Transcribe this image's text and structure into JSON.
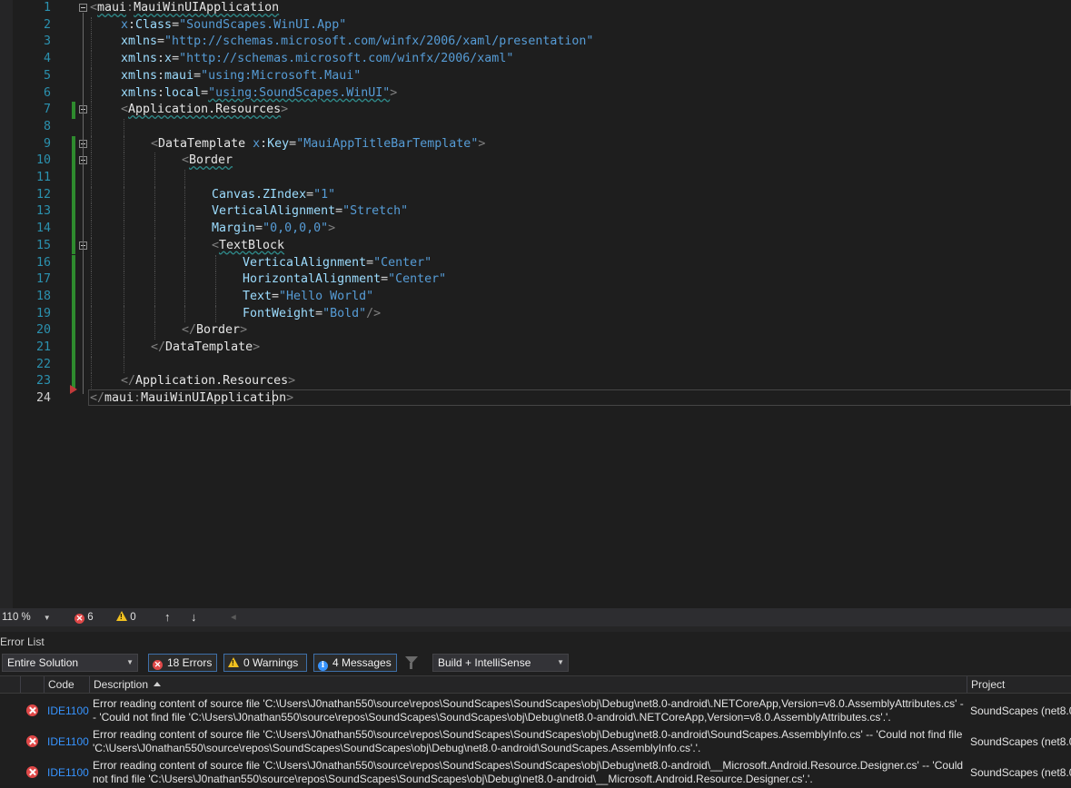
{
  "editor": {
    "lines": [
      {
        "n": "1"
      },
      {
        "n": "2"
      },
      {
        "n": "3"
      },
      {
        "n": "4"
      },
      {
        "n": "5"
      },
      {
        "n": "6"
      },
      {
        "n": "7"
      },
      {
        "n": "8"
      },
      {
        "n": "9"
      },
      {
        "n": "10"
      },
      {
        "n": "11"
      },
      {
        "n": "12"
      },
      {
        "n": "13"
      },
      {
        "n": "14"
      },
      {
        "n": "15"
      },
      {
        "n": "16"
      },
      {
        "n": "17"
      },
      {
        "n": "18"
      },
      {
        "n": "19"
      },
      {
        "n": "20"
      },
      {
        "n": "21"
      },
      {
        "n": "22"
      },
      {
        "n": "23"
      },
      {
        "n": "24"
      }
    ],
    "code": {
      "l1": {
        "lt": "<",
        "prefix": "maui",
        "colon": ":",
        "name": "MauiWinUIApplication"
      },
      "l2": {
        "attr_prefix": "x",
        "colon": ":",
        "attr": "Class",
        "eq": "=",
        "value": "\"SoundScapes.WinUI.App\""
      },
      "l3": {
        "attr": "xmlns",
        "eq": "=",
        "value": "\"http://schemas.microsoft.com/winfx/2006/xaml/presentation\""
      },
      "l4": {
        "attr": "xmlns",
        "colon": ":",
        "attr2": "x",
        "eq": "=",
        "value": "\"http://schemas.microsoft.com/winfx/2006/xaml\""
      },
      "l5": {
        "attr": "xmlns",
        "colon": ":",
        "attr2": "maui",
        "eq": "=",
        "value": "\"using:Microsoft.Maui\""
      },
      "l6": {
        "attr": "xmlns",
        "colon": ":",
        "attr2": "local",
        "eq": "=",
        "value": "\"using:SoundScapes.WinUI\"",
        "gt": ">"
      },
      "l7": {
        "lt": "<",
        "name": "Application.Resources",
        "gt": ">"
      },
      "l9": {
        "lt": "<",
        "name": "DataTemplate",
        "attr_prefix": "x",
        "colon": ":",
        "attr": "Key",
        "eq": "=",
        "value": "\"MauiAppTitleBarTemplate\"",
        "gt": ">"
      },
      "l10": {
        "lt": "<",
        "name": "Border"
      },
      "l12": {
        "attr": "Canvas.ZIndex",
        "eq": "=",
        "value": "\"1\""
      },
      "l13": {
        "attr": "VerticalAlignment",
        "eq": "=",
        "value": "\"Stretch\""
      },
      "l14": {
        "attr": "Margin",
        "eq": "=",
        "value": "\"0,0,0,0\"",
        "gt": ">"
      },
      "l15": {
        "lt": "<",
        "name": "TextBlock"
      },
      "l16": {
        "attr": "VerticalAlignment",
        "eq": "=",
        "value": "\"Center\""
      },
      "l17": {
        "attr": "HorizontalAlignment",
        "eq": "=",
        "value": "\"Center\""
      },
      "l18": {
        "attr": "Text",
        "eq": "=",
        "value": "\"Hello World\""
      },
      "l19": {
        "attr": "FontWeight",
        "eq": "=",
        "value": "\"Bold\"",
        "close": "/>"
      },
      "l20": {
        "lt": "</",
        "name": "Border",
        "gt": ">"
      },
      "l21": {
        "lt": "</",
        "name": "DataTemplate",
        "gt": ">"
      },
      "l23": {
        "lt": "</",
        "name": "Application.Resources",
        "gt": ">"
      },
      "l24": {
        "lt": "</",
        "prefix": "maui",
        "colon": ":",
        "name": "MauiWinUIApplication",
        "gt": ">"
      }
    }
  },
  "statusbar": {
    "zoom": "110 %",
    "errors": "6",
    "warnings": "0",
    "up_arrow": "↑",
    "down_arrow": "↓",
    "left_arrow": "◂"
  },
  "error_list": {
    "title": "Error List",
    "scope_select": "Entire Solution",
    "errors_button": "18 Errors",
    "warnings_button": "0 Warnings",
    "messages_button": "4 Messages",
    "build_select": "Build + IntelliSense",
    "columns": {
      "code": "Code",
      "description": "Description",
      "project": "Project"
    },
    "rows": [
      {
        "code": "IDE1100",
        "description": "Error reading content of source file 'C:\\Users\\J0nathan550\\source\\repos\\SoundScapes\\SoundScapes\\obj\\Debug\\net8.0-android\\.NETCoreApp,Version=v8.0.AssemblyAttributes.cs' -- 'Could not find file 'C:\\Users\\J0nathan550\\source\\repos\\SoundScapes\\SoundScapes\\obj\\Debug\\net8.0-android\\.NETCoreApp,Version=v8.0.AssemblyAttributes.cs'.'.",
        "project": "SoundScapes (net8.0-"
      },
      {
        "code": "IDE1100",
        "description": "Error reading content of source file 'C:\\Users\\J0nathan550\\source\\repos\\SoundScapes\\SoundScapes\\obj\\Debug\\net8.0-android\\SoundScapes.AssemblyInfo.cs' -- 'Could not find file 'C:\\Users\\J0nathan550\\source\\repos\\SoundScapes\\SoundScapes\\obj\\Debug\\net8.0-android\\SoundScapes.AssemblyInfo.cs'.'.",
        "project": "SoundScapes (net8.0-"
      },
      {
        "code": "IDE1100",
        "description": "Error reading content of source file 'C:\\Users\\J0nathan550\\source\\repos\\SoundScapes\\SoundScapes\\obj\\Debug\\net8.0-android\\__Microsoft.Android.Resource.Designer.cs' -- 'Could not find file 'C:\\Users\\J0nathan550\\source\\repos\\SoundScapes\\SoundScapes\\obj\\Debug\\net8.0-android\\__Microsoft.Android.Resource.Designer.cs'.'.",
        "project": "SoundScapes (net8.0-"
      }
    ]
  },
  "colors": {
    "editor_bg": "#1e1e1e",
    "line_number": "#2b91af",
    "change_bar": "#2e8b2e",
    "error_red": "#e04848",
    "link_blue": "#3794ff"
  }
}
